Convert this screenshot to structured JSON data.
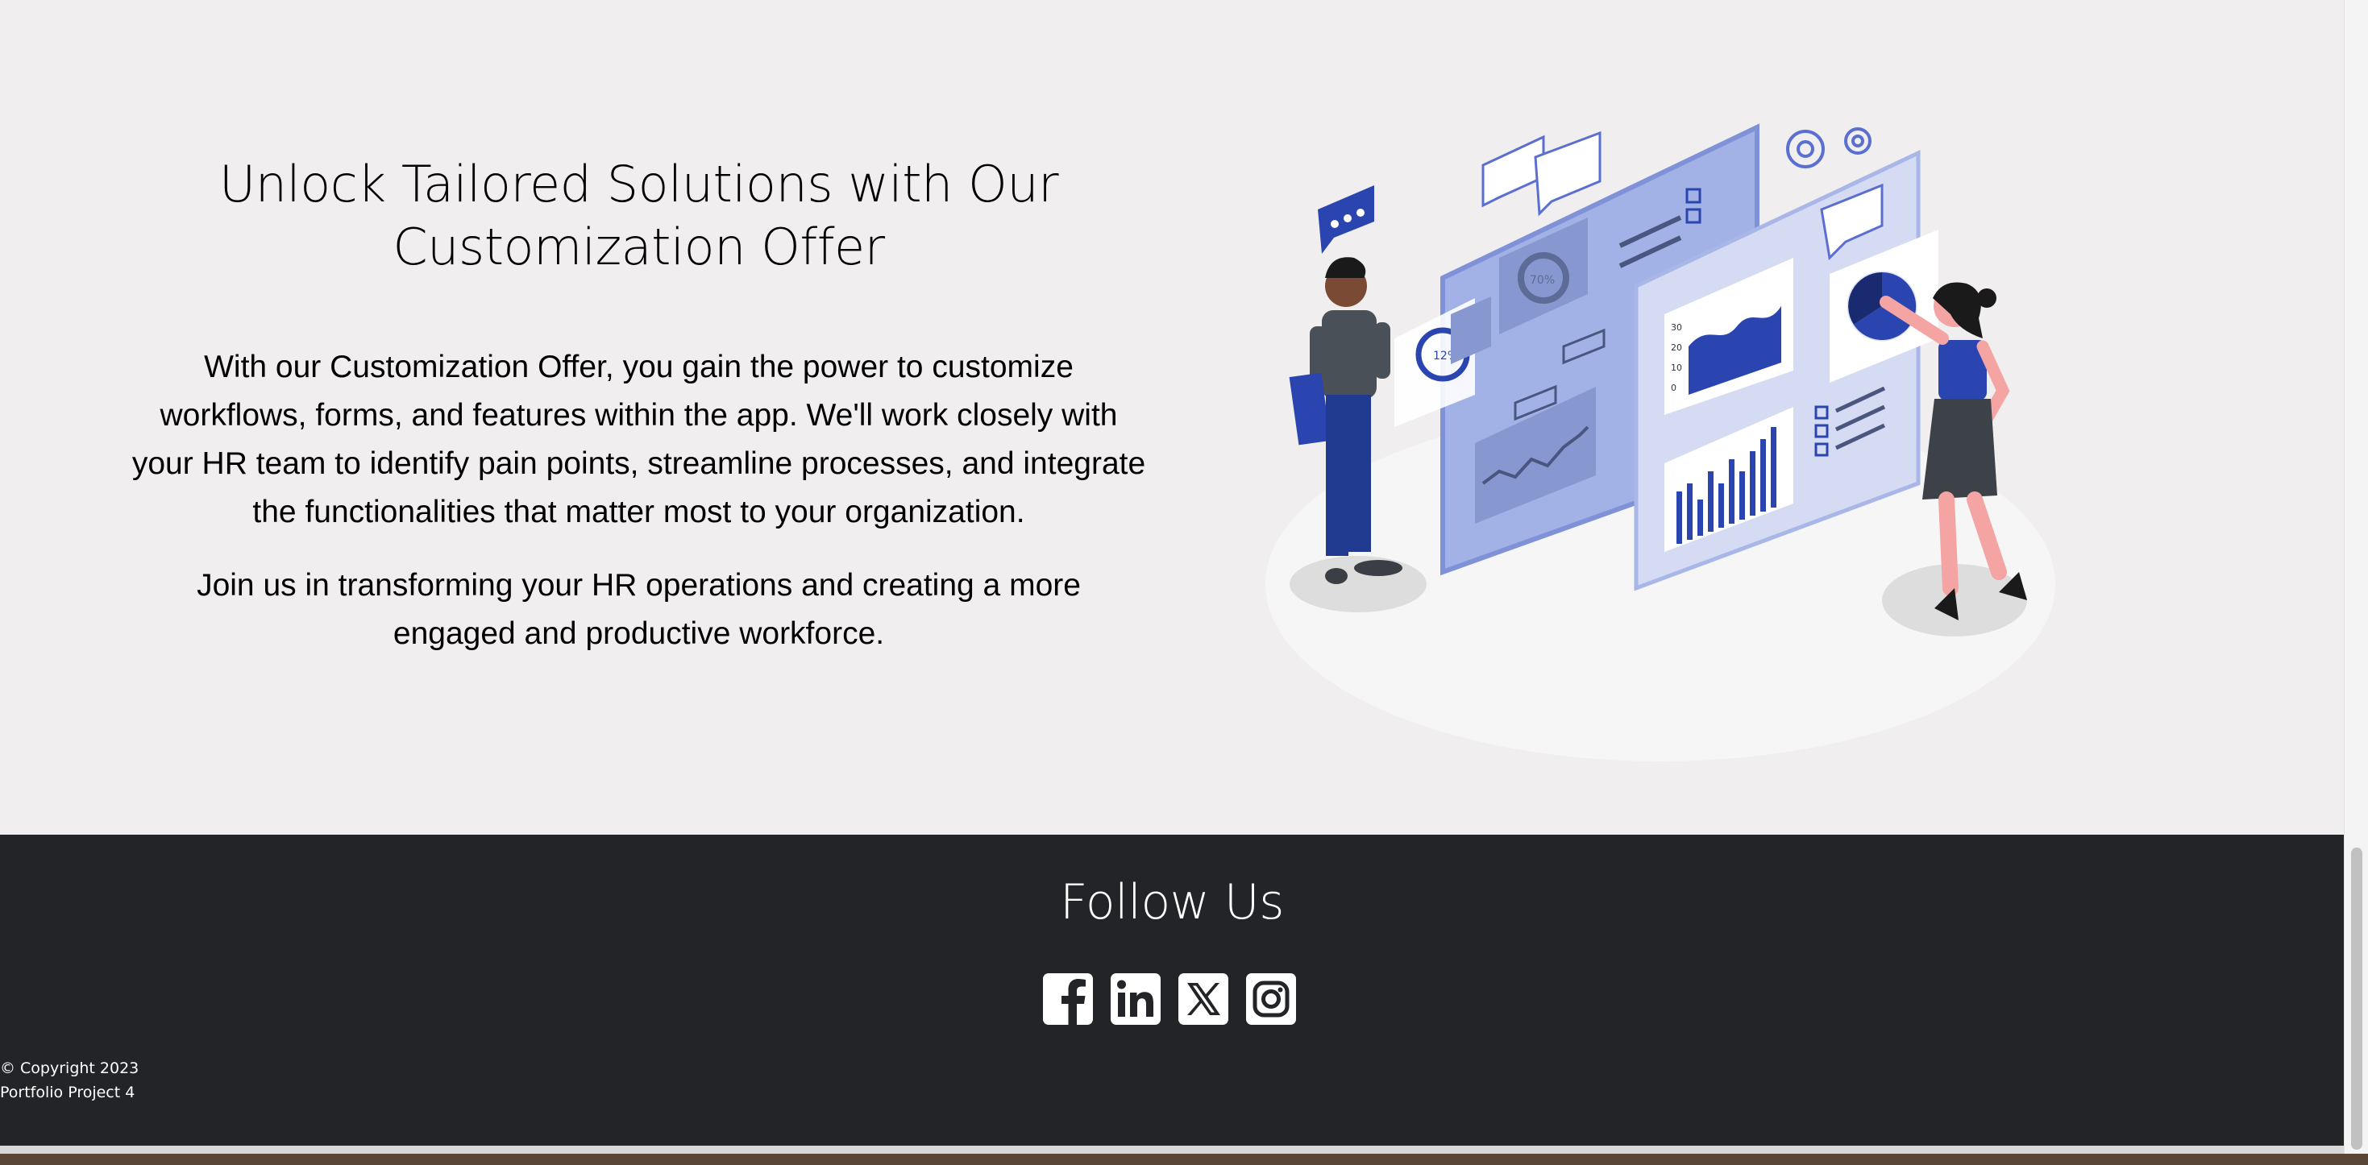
{
  "hero": {
    "title": "Unlock Tailored Solutions with Our Customization Offer",
    "paragraph1": "With our Customization Offer, you gain the power to customize workflows, forms, and features within the app. We'll work closely with your HR team to identify pain points, streamline processes, and integrate the functionalities that matter most to your organization.",
    "paragraph2": "Join us in transforming your HR operations and creating a more engaged and productive workforce.",
    "illustration_icon": "hr-dashboard-illustration"
  },
  "footer": {
    "title": "Follow Us",
    "social_links": [
      {
        "name": "facebook",
        "icon": "facebook-icon"
      },
      {
        "name": "linkedin",
        "icon": "linkedin-icon"
      },
      {
        "name": "x",
        "icon": "x-twitter-icon"
      },
      {
        "name": "instagram",
        "icon": "instagram-icon"
      }
    ],
    "copyright": "© Copyright 2023",
    "project": "Portfolio Project 4"
  },
  "illustration_labels": {
    "gauge_left": "12%",
    "gauge_center": "70%",
    "chart_ticks": [
      "30",
      "20",
      "10",
      "0"
    ]
  },
  "colors": {
    "page_bg": "#f0eeef",
    "footer_bg": "#222428",
    "accent_blue": "#2a45b0",
    "panel_blue": "#9aa9e0"
  }
}
